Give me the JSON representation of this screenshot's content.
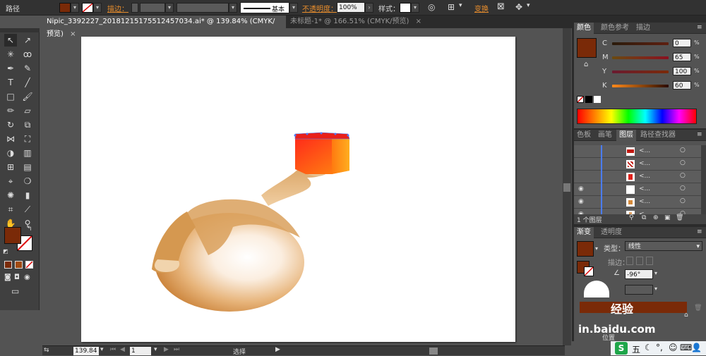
{
  "control_bar": {
    "path_label": "路径",
    "stroke_label": "描边：",
    "stroke_profile": "基本",
    "opacity_label": "不透明度：",
    "opacity_value": "100%",
    "style_label": "样式：",
    "transform_label": "变换",
    "fill_color": "#7a2a08"
  },
  "tabs": [
    {
      "label": "Nipic_3392227_20181215175512457034.ai* @ 139.84% (CMYK/预览)"
    },
    {
      "label": "未标题-1* @ 166.51% (CMYK/预览)"
    }
  ],
  "status_bar": {
    "zoom": "139.84",
    "page": "1",
    "mode": "选择"
  },
  "color_panel": {
    "tabs": [
      "颜色",
      "颜色参考",
      "描边"
    ],
    "channels": [
      {
        "label": "C",
        "value": "0"
      },
      {
        "label": "M",
        "value": "65"
      },
      {
        "label": "Y",
        "value": "100"
      },
      {
        "label": "K",
        "value": "60"
      }
    ],
    "unit": "%",
    "swatch_color": "#7a2a08"
  },
  "layers_panel": {
    "tabs": [
      "色板",
      "画笔",
      "图层",
      "路径查找器"
    ],
    "footer_label": "1 个图层",
    "row_marker": "<..."
  },
  "gradient_panel": {
    "tabs": [
      "渐变",
      "透明度"
    ],
    "type_label": "类型：",
    "type_value": "线性",
    "stroke_label": "描边：",
    "angle_value": "-96°",
    "position_label": "位置"
  },
  "watermark": {
    "text": "经验",
    "url": "in.baidu.com"
  },
  "taskbar": {
    "ime_label": "五"
  }
}
